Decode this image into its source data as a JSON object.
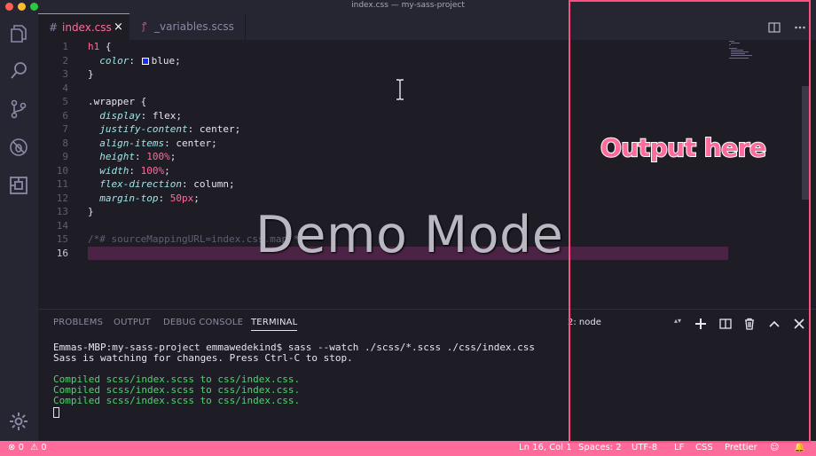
{
  "window": {
    "title": "index.css — my-sass-project"
  },
  "activity_bar": {
    "items": [
      {
        "name": "explorer",
        "icon": "files-icon"
      },
      {
        "name": "search",
        "icon": "search-icon"
      },
      {
        "name": "source-control",
        "icon": "git-branch-icon"
      },
      {
        "name": "debug",
        "icon": "bug-icon"
      },
      {
        "name": "extensions",
        "icon": "extensions-icon"
      }
    ],
    "settings_icon": "gear-icon"
  },
  "tabs": [
    {
      "label": "index.css",
      "icon": "#",
      "active": true,
      "close": "×"
    },
    {
      "label": "_variables.scss",
      "icon": "sass-icon",
      "active": false
    }
  ],
  "editor": {
    "line_numbers": [
      "1",
      "2",
      "3",
      "4",
      "5",
      "6",
      "7",
      "8",
      "9",
      "10",
      "11",
      "12",
      "13",
      "14",
      "15",
      "16"
    ],
    "current_line": 16,
    "code": {
      "l1_sel": "h1",
      "l1_brace": " {",
      "l2_prop": "color",
      "l2_val": "blue;",
      "l3": "}",
      "l5_sel": ".wrapper",
      "l5_brace": " {",
      "l6_prop": "display",
      "l6_val": "flex;",
      "l7_prop": "justify-content",
      "l7_val": "center;",
      "l8_prop": "align-items",
      "l8_val": "center;",
      "l9_prop": "height",
      "l9_val": "100%",
      "l10_prop": "width",
      "l10_val": "100%",
      "l11_prop": "flex-direction",
      "l11_val": "column;",
      "l12_prop": "margin-top",
      "l12_val": "50px",
      "l13": "}",
      "l15": "/*# sourceMappingURL=index.css.map */"
    },
    "swatch_color": "#1a2fe0"
  },
  "overlays": {
    "demo_mode": "Demo Mode",
    "output_label": "Output here",
    "output_border_color": "#ff4f7e"
  },
  "panel": {
    "tabs": [
      "PROBLEMS",
      "OUTPUT",
      "DEBUG CONSOLE",
      "TERMINAL"
    ],
    "active_tab": "TERMINAL",
    "terminal_select": "2: node",
    "terminal": {
      "line1": "Emmas-MBP:my-sass-project emmawedekind$ sass --watch ./scss/*.scss ./css/index.css",
      "line2": "Sass is watching for changes. Press Ctrl-C to stop.",
      "compiled": [
        "Compiled scss/index.scss to css/index.css.",
        "Compiled scss/index.scss to css/index.css.",
        "Compiled scss/index.scss to css/index.css."
      ]
    }
  },
  "status_bar": {
    "errors": "0",
    "warnings": "0",
    "position": "Ln 16, Col 1",
    "spaces": "Spaces: 2",
    "encoding": "UTF-8",
    "eol": "LF",
    "language": "CSS",
    "formatter": "Prettier",
    "color": "#ff6b9a"
  }
}
